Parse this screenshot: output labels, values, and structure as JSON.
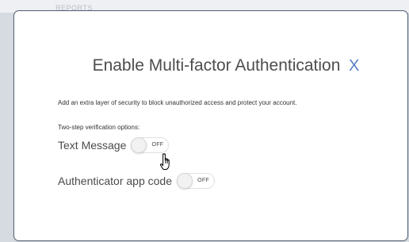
{
  "background": {
    "faint_text": "REPORTS"
  },
  "modal": {
    "title": "Enable Multi-factor Authentication",
    "close_label": "X",
    "description": "Add an extra layer of security to block unauthorized access and protect your account.",
    "options_label": "Two-step verification options:",
    "options": [
      {
        "label": "Text Message",
        "state": "OFF",
        "enabled": false
      },
      {
        "label": "Authenticator app code",
        "state": "OFF",
        "enabled": false
      }
    ]
  },
  "colors": {
    "accent": "#5b7fc4",
    "text": "#4a4a4a"
  },
  "icons": {
    "cursor": "hand-pointer-icon"
  }
}
